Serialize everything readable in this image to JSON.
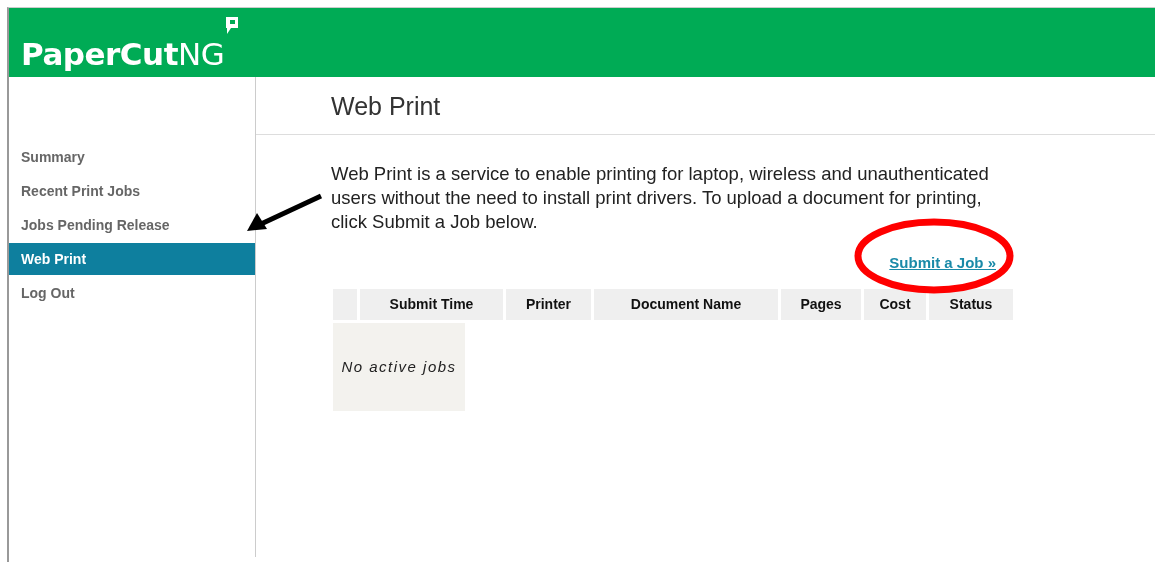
{
  "header": {
    "logo": "**PaperCut**NG"
  },
  "sidebar": {
    "items": [
      {
        "label": "Summary",
        "selected": false
      },
      {
        "label": "Recent Print Jobs",
        "selected": false
      },
      {
        "label": "Jobs Pending Release",
        "selected": false
      },
      {
        "label": "Web Print",
        "selected": true
      },
      {
        "label": "Log Out",
        "selected": false
      }
    ]
  },
  "page": {
    "title": "Web Print",
    "description": "Web Print is a service to enable printing for laptop, wireless and unauthenticated users without the need to install print drivers. To upload a document for printing, click Submit a Job below.",
    "submit_link": "Submit a Job »"
  },
  "table": {
    "columns": [
      "",
      "Submit Time",
      "Printer",
      "Document Name",
      "Pages",
      "Cost",
      "Status"
    ],
    "empty_message": "No active jobs"
  }
}
